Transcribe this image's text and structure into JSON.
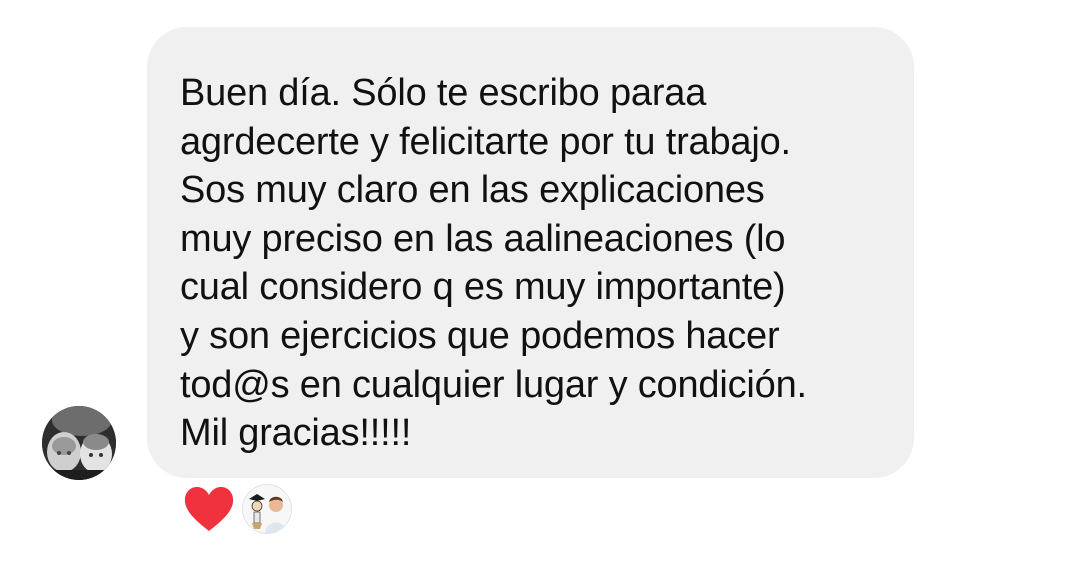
{
  "message": {
    "sender_avatar_icon": "sender-avatar",
    "text": "Buen día. Sólo te escribo paraa\nagrdecerte y felicitarte por tu trabajo.\nSos muy claro en las explicaciones\nmuy preciso en las aalineaciones (lo\ncual considero q es muy importante)\ny son ejercicios que podemos hacer\ntod@s en cualquier lugar y condición.\nMil gracias!!!!!",
    "bubble_color": "#f0f0f0",
    "text_color": "#111111"
  },
  "reactions": {
    "emoji_icon": "heart-icon",
    "emoji_color": "#f0323f",
    "reactor_icon": "reactor-avatar"
  }
}
